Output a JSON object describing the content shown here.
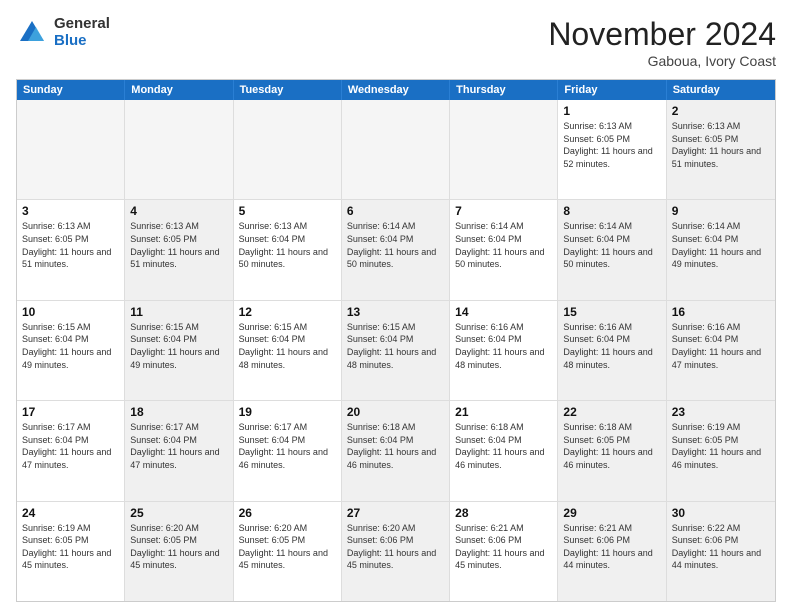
{
  "logo": {
    "general": "General",
    "blue": "Blue"
  },
  "title": "November 2024",
  "location": "Gaboua, Ivory Coast",
  "weekdays": [
    "Sunday",
    "Monday",
    "Tuesday",
    "Wednesday",
    "Thursday",
    "Friday",
    "Saturday"
  ],
  "rows": [
    [
      {
        "day": "",
        "empty": true
      },
      {
        "day": "",
        "empty": true
      },
      {
        "day": "",
        "empty": true
      },
      {
        "day": "",
        "empty": true
      },
      {
        "day": "",
        "empty": true
      },
      {
        "day": "1",
        "info": "Sunrise: 6:13 AM\nSunset: 6:05 PM\nDaylight: 11 hours and 52 minutes."
      },
      {
        "day": "2",
        "info": "Sunrise: 6:13 AM\nSunset: 6:05 PM\nDaylight: 11 hours and 51 minutes.",
        "shaded": true
      }
    ],
    [
      {
        "day": "3",
        "info": "Sunrise: 6:13 AM\nSunset: 6:05 PM\nDaylight: 11 hours and 51 minutes."
      },
      {
        "day": "4",
        "info": "Sunrise: 6:13 AM\nSunset: 6:05 PM\nDaylight: 11 hours and 51 minutes.",
        "shaded": true
      },
      {
        "day": "5",
        "info": "Sunrise: 6:13 AM\nSunset: 6:04 PM\nDaylight: 11 hours and 50 minutes."
      },
      {
        "day": "6",
        "info": "Sunrise: 6:14 AM\nSunset: 6:04 PM\nDaylight: 11 hours and 50 minutes.",
        "shaded": true
      },
      {
        "day": "7",
        "info": "Sunrise: 6:14 AM\nSunset: 6:04 PM\nDaylight: 11 hours and 50 minutes."
      },
      {
        "day": "8",
        "info": "Sunrise: 6:14 AM\nSunset: 6:04 PM\nDaylight: 11 hours and 50 minutes.",
        "shaded": true
      },
      {
        "day": "9",
        "info": "Sunrise: 6:14 AM\nSunset: 6:04 PM\nDaylight: 11 hours and 49 minutes.",
        "shaded": true
      }
    ],
    [
      {
        "day": "10",
        "info": "Sunrise: 6:15 AM\nSunset: 6:04 PM\nDaylight: 11 hours and 49 minutes."
      },
      {
        "day": "11",
        "info": "Sunrise: 6:15 AM\nSunset: 6:04 PM\nDaylight: 11 hours and 49 minutes.",
        "shaded": true
      },
      {
        "day": "12",
        "info": "Sunrise: 6:15 AM\nSunset: 6:04 PM\nDaylight: 11 hours and 48 minutes."
      },
      {
        "day": "13",
        "info": "Sunrise: 6:15 AM\nSunset: 6:04 PM\nDaylight: 11 hours and 48 minutes.",
        "shaded": true
      },
      {
        "day": "14",
        "info": "Sunrise: 6:16 AM\nSunset: 6:04 PM\nDaylight: 11 hours and 48 minutes."
      },
      {
        "day": "15",
        "info": "Sunrise: 6:16 AM\nSunset: 6:04 PM\nDaylight: 11 hours and 48 minutes.",
        "shaded": true
      },
      {
        "day": "16",
        "info": "Sunrise: 6:16 AM\nSunset: 6:04 PM\nDaylight: 11 hours and 47 minutes.",
        "shaded": true
      }
    ],
    [
      {
        "day": "17",
        "info": "Sunrise: 6:17 AM\nSunset: 6:04 PM\nDaylight: 11 hours and 47 minutes."
      },
      {
        "day": "18",
        "info": "Sunrise: 6:17 AM\nSunset: 6:04 PM\nDaylight: 11 hours and 47 minutes.",
        "shaded": true
      },
      {
        "day": "19",
        "info": "Sunrise: 6:17 AM\nSunset: 6:04 PM\nDaylight: 11 hours and 46 minutes."
      },
      {
        "day": "20",
        "info": "Sunrise: 6:18 AM\nSunset: 6:04 PM\nDaylight: 11 hours and 46 minutes.",
        "shaded": true
      },
      {
        "day": "21",
        "info": "Sunrise: 6:18 AM\nSunset: 6:04 PM\nDaylight: 11 hours and 46 minutes."
      },
      {
        "day": "22",
        "info": "Sunrise: 6:18 AM\nSunset: 6:05 PM\nDaylight: 11 hours and 46 minutes.",
        "shaded": true
      },
      {
        "day": "23",
        "info": "Sunrise: 6:19 AM\nSunset: 6:05 PM\nDaylight: 11 hours and 46 minutes.",
        "shaded": true
      }
    ],
    [
      {
        "day": "24",
        "info": "Sunrise: 6:19 AM\nSunset: 6:05 PM\nDaylight: 11 hours and 45 minutes."
      },
      {
        "day": "25",
        "info": "Sunrise: 6:20 AM\nSunset: 6:05 PM\nDaylight: 11 hours and 45 minutes.",
        "shaded": true
      },
      {
        "day": "26",
        "info": "Sunrise: 6:20 AM\nSunset: 6:05 PM\nDaylight: 11 hours and 45 minutes."
      },
      {
        "day": "27",
        "info": "Sunrise: 6:20 AM\nSunset: 6:06 PM\nDaylight: 11 hours and 45 minutes.",
        "shaded": true
      },
      {
        "day": "28",
        "info": "Sunrise: 6:21 AM\nSunset: 6:06 PM\nDaylight: 11 hours and 45 minutes."
      },
      {
        "day": "29",
        "info": "Sunrise: 6:21 AM\nSunset: 6:06 PM\nDaylight: 11 hours and 44 minutes.",
        "shaded": true
      },
      {
        "day": "30",
        "info": "Sunrise: 6:22 AM\nSunset: 6:06 PM\nDaylight: 11 hours and 44 minutes.",
        "shaded": true
      }
    ]
  ]
}
